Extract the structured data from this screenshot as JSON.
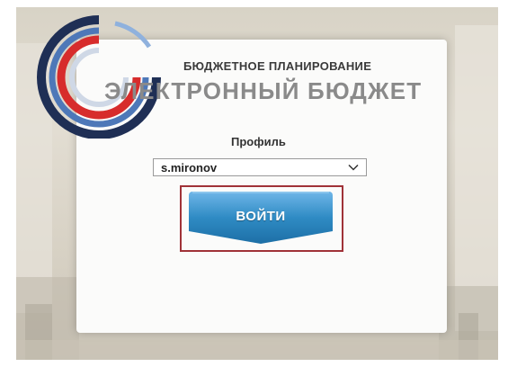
{
  "app": {
    "subtitle": "БЮДЖЕТНОЕ ПЛАНИРОВАНИЕ",
    "title": "ЭЛЕКТРОННЫЙ БЮДЖЕТ"
  },
  "form": {
    "profile_label": "Профиль",
    "profile_value": "s.mironov",
    "login_button": "ВОЙТИ"
  },
  "colors": {
    "button": "#2f8bc4",
    "highlight": "#a03238",
    "logo_red": "#d72c2c",
    "logo_blue": "#2a4a86"
  },
  "icons": {
    "logo": "budget-logo-icon",
    "dropdown": "chevron-down-icon"
  }
}
